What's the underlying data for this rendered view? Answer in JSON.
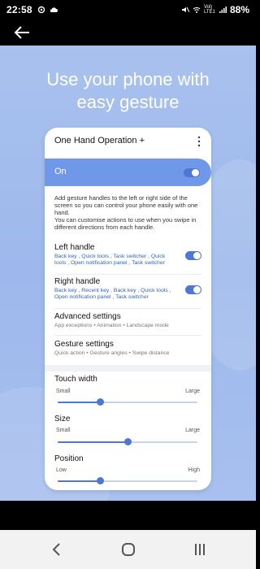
{
  "status": {
    "time": "22:58",
    "battery": "88%",
    "network": "Vol) LTE1"
  },
  "hero": {
    "title_line1": "Use your phone with",
    "title_line2": "easy gesture"
  },
  "phone": {
    "header_title": "One Hand Operation +",
    "on_label": "On",
    "description": "Add gesture handles to the left or right side of the screen so you can control your phone easily with one hand.\nYou can customise actions to use when you swipe in different directions from each handle.",
    "left_handle": {
      "title": "Left handle",
      "subtitle": "Back key , Quick tools , Task switcher , Quick tools , Open notification panel , Task switcher"
    },
    "right_handle": {
      "title": "Right handle",
      "subtitle": "Back key , Recent key , Back key , Quick tools , Open notification panel , Task switcher"
    },
    "advanced": {
      "title": "Advanced settings",
      "subtitle": "App exceptions • Animation • Landscape mode"
    },
    "gesture": {
      "title": "Gesture settings",
      "subtitle": "Quick action • Gesture angles • Swipe distance"
    },
    "touch_width": {
      "title": "Touch width",
      "min": "Small",
      "max": "Large",
      "value": 0.3
    },
    "size": {
      "title": "Size",
      "min": "Small",
      "max": "Large",
      "value": 0.5
    },
    "position": {
      "title": "Position",
      "min": "Low",
      "max": "High",
      "value": 0.3
    }
  },
  "colors": {
    "accent": "#4b78d4",
    "hero_bg": "#a9c1ee",
    "on_bar": "#6f98e8"
  },
  "icons": {
    "back": "back-arrow-icon",
    "more": "more-vertical-icon",
    "nav_back": "chevron-left-icon",
    "nav_home": "home-circle-icon",
    "nav_recents": "recents-icon"
  }
}
